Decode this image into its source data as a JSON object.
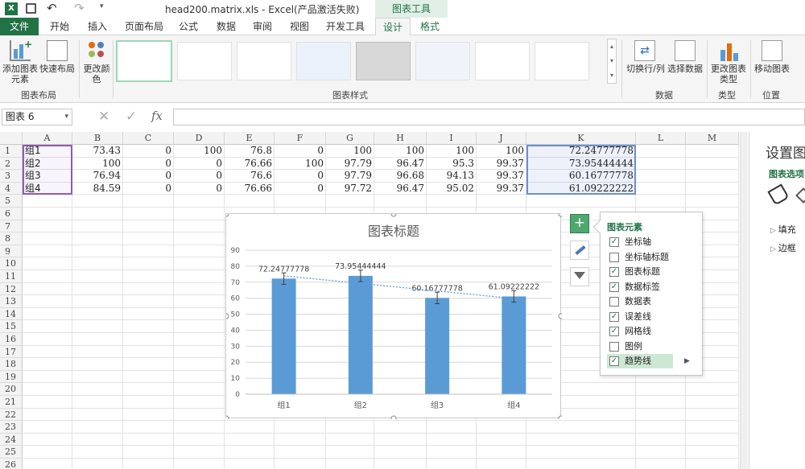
{
  "window": {
    "title": "head200.matrix.xls - Excel(产品激活失败)",
    "context_tab": "图表工具"
  },
  "tabs": [
    "文件",
    "开始",
    "插入",
    "页面布局",
    "公式",
    "数据",
    "审阅",
    "视图",
    "开发工具",
    "设计",
    "格式"
  ],
  "ribbon": {
    "add_element": "添加图表元素",
    "quick_layout": "快速布局",
    "change_color": "更改颜色",
    "group_layout": "图表布局",
    "group_styles": "图表样式",
    "switch_rowcol": "切换行/列",
    "select_data": "选择数据",
    "group_data": "数据",
    "change_type": "更改图表类型",
    "group_type": "类型",
    "move_chart": "移动图表",
    "group_location": "位置"
  },
  "formula_bar": {
    "name_box": "图表 6",
    "formula": ""
  },
  "columns": [
    "A",
    "B",
    "C",
    "D",
    "E",
    "F",
    "G",
    "H",
    "I",
    "J",
    "K",
    "L",
    "M"
  ],
  "rows": [
    "1",
    "2",
    "3",
    "4",
    "5",
    "6",
    "7",
    "8",
    "9",
    "10",
    "11",
    "12",
    "13",
    "14",
    "15",
    "16",
    "17",
    "18",
    "19",
    "20",
    "21",
    "22",
    "23",
    "24",
    "25",
    "26"
  ],
  "table": [
    [
      "组1",
      "73.43",
      "0",
      "100",
      "76.8",
      "0",
      "100",
      "100",
      "100",
      "100",
      "72.24777778"
    ],
    [
      "组2",
      "100",
      "0",
      "0",
      "76.66",
      "100",
      "97.79",
      "96.47",
      "95.3",
      "99.37",
      "73.95444444"
    ],
    [
      "组3",
      "76.94",
      "0",
      "0",
      "76.6",
      "0",
      "97.79",
      "96.68",
      "94.13",
      "99.37",
      "60.16777778"
    ],
    [
      "组4",
      "84.59",
      "0",
      "0",
      "76.66",
      "0",
      "97.72",
      "96.47",
      "95.02",
      "99.37",
      "61.09222222"
    ]
  ],
  "side_pane": {
    "title": "设置图",
    "subtitle": "图表选项",
    "fill": "填充",
    "border": "边框"
  },
  "popup": {
    "title": "图表元素",
    "items": [
      {
        "label": "坐标轴",
        "checked": true
      },
      {
        "label": "坐标轴标题",
        "checked": false
      },
      {
        "label": "图表标题",
        "checked": true
      },
      {
        "label": "数据标签",
        "checked": true
      },
      {
        "label": "数据表",
        "checked": false
      },
      {
        "label": "误差线",
        "checked": true
      },
      {
        "label": "网格线",
        "checked": true
      },
      {
        "label": "图例",
        "checked": false
      },
      {
        "label": "趋势线",
        "checked": true
      }
    ]
  },
  "colors": {
    "excel_green": "#217346",
    "bar": "#5b9bd5",
    "tab_active_text": "#217346"
  },
  "chart_data": {
    "type": "bar",
    "title": "图表标题",
    "categories": [
      "组1",
      "组2",
      "组3",
      "组4"
    ],
    "values": [
      72.24777778,
      73.95444444,
      60.16777778,
      61.09222222
    ],
    "data_labels": [
      "72.24777778",
      "73.95444444",
      "60.16777778",
      "61.09222222"
    ],
    "ylim": [
      0,
      90
    ],
    "yticks": [
      "0",
      "10",
      "20",
      "30",
      "40",
      "50",
      "60",
      "70",
      "80",
      "90"
    ],
    "grid": true,
    "error_bars": true,
    "trendline": "linear dotted"
  }
}
